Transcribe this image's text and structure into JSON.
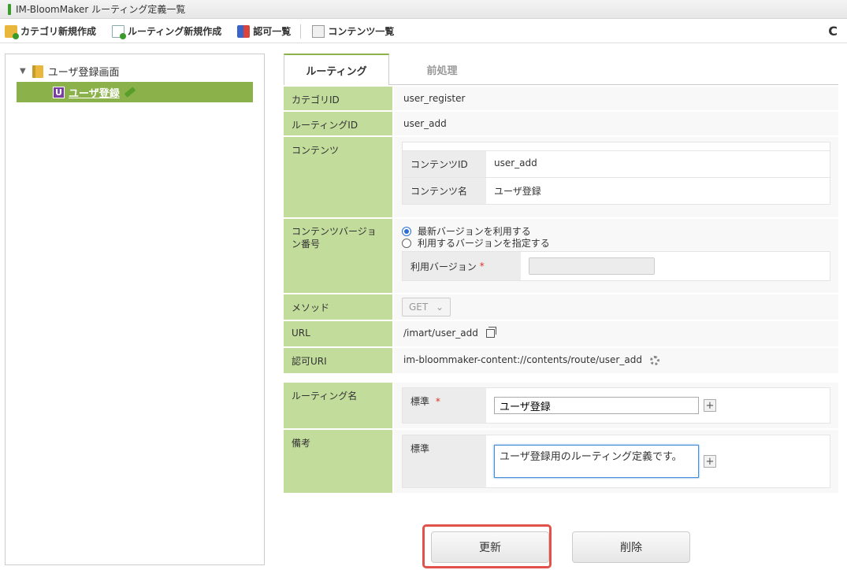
{
  "window": {
    "title": "IM-BloomMaker ルーティング定義一覧"
  },
  "toolbar": {
    "new_category": "カテゴリ新規作成",
    "new_routing": "ルーティング新規作成",
    "auth_list": "認可一覧",
    "contents_list": "コンテンツ一覧",
    "refresh_glyph": "C"
  },
  "tree": {
    "root_label": "ユーザ登録画面",
    "selected_label": "ユーザ登録",
    "selected_badge": "U"
  },
  "tabs": {
    "routing": "ルーティング",
    "preprocess": "前処理"
  },
  "form": {
    "category_id_label": "カテゴリID",
    "category_id_value": "user_register",
    "routing_id_label": "ルーティングID",
    "routing_id_value": "user_add",
    "contents_label": "コンテンツ",
    "contents_id_label": "コンテンツID",
    "contents_id_value": "user_add",
    "contents_name_label": "コンテンツ名",
    "contents_name_value": "ユーザ登録",
    "version_label": "コンテンツバージョン番号",
    "version_opt_latest": "最新バージョンを利用する",
    "version_opt_specify": "利用するバージョンを指定する",
    "use_version_label": "利用バージョン",
    "required_mark": "*",
    "method_label": "メソッド",
    "method_value": "GET",
    "url_label": "URL",
    "url_value": "/imart/user_add",
    "auth_uri_label": "認可URI",
    "auth_uri_value": "im-bloommaker-content://contents/route/user_add",
    "routing_name_label": "ルーティング名",
    "standard_label": "標準",
    "routing_name_value": "ユーザ登録",
    "note_label": "備考",
    "note_value": "ユーザ登録用のルーティング定義です。",
    "plus_glyph": "+"
  },
  "actions": {
    "update": "更新",
    "delete": "削除"
  }
}
